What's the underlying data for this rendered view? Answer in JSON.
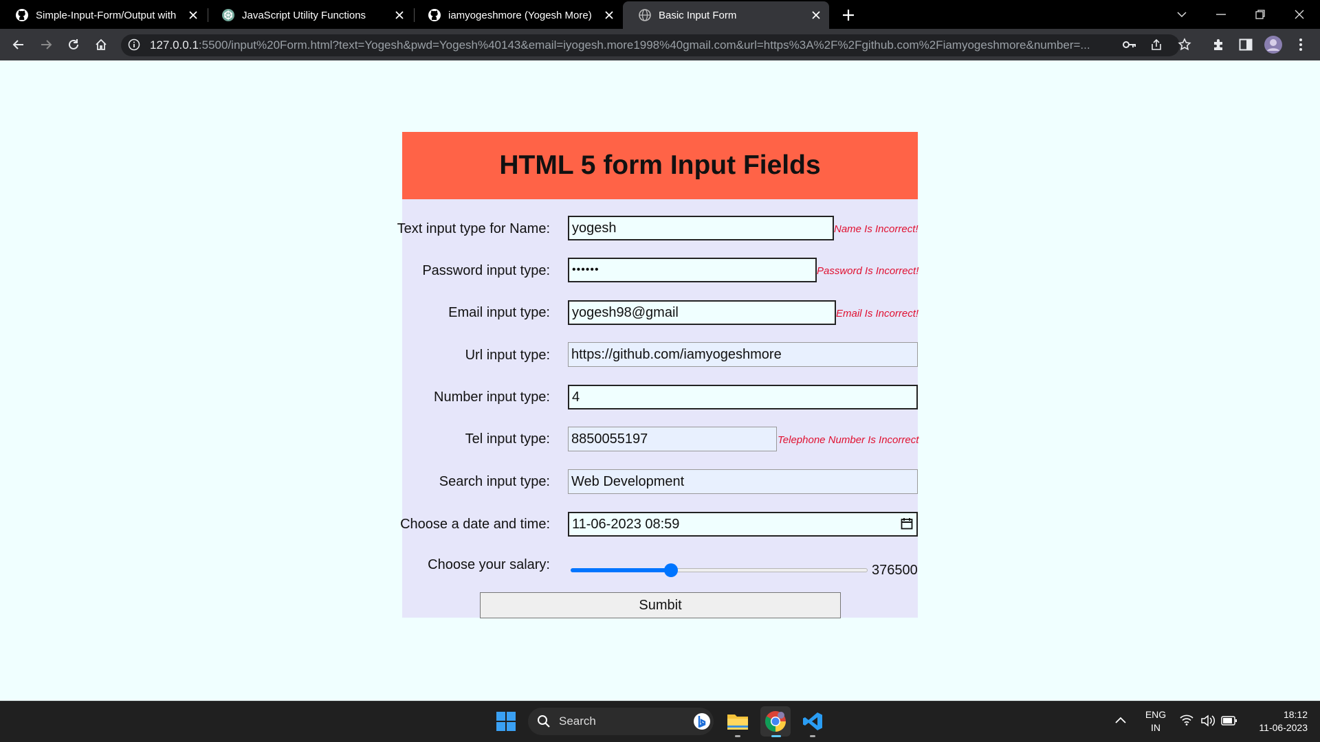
{
  "browser": {
    "tabs": [
      {
        "title": "Simple-Input-Form/Output with",
        "icon": "github-icon"
      },
      {
        "title": "JavaScript Utility Functions",
        "icon": "chatgpt-icon"
      },
      {
        "title": "iamyogeshmore (Yogesh More)",
        "icon": "github-icon"
      },
      {
        "title": "Basic Input Form",
        "icon": "globe-icon",
        "active": true
      }
    ],
    "url_host": "127.0.0.1",
    "url_rest": ":5500/input%20Form.html?text=Yogesh&pwd=Yogesh%40143&email=iyogesh.more1998%40gmail.com&url=https%3A%2F%2Fgithub.com%2Fiamyogeshmore&number=..."
  },
  "form": {
    "title": "HTML 5 form Input Fields",
    "fields": {
      "name": {
        "label": "Text input type for Name:",
        "value": "yogesh",
        "error": "Name Is Incorrect!"
      },
      "password": {
        "label": "Password input type:",
        "value": "••••••",
        "error": "Password Is Incorrect!"
      },
      "email": {
        "label": "Email input type:",
        "value": "yogesh98@gmail",
        "error": "Email Is Incorrect!"
      },
      "url": {
        "label": "Url input type:",
        "value": "https://github.com/iamyogeshmore"
      },
      "number": {
        "label": "Number input type:",
        "value": "4"
      },
      "tel": {
        "label": "Tel input type:",
        "value": "8850055197",
        "error": "Telephone Number Is Incorrect"
      },
      "search": {
        "label": "Search input type:",
        "value": "Web Development"
      },
      "datetime": {
        "label": "Choose a date and time:",
        "value": "11-06-2023 08:59"
      },
      "salary": {
        "label": "Choose your salary:",
        "value": "376500",
        "fraction": 0.33
      }
    },
    "submit_label": "Sumbit"
  },
  "colors": {
    "header": "#ff6347",
    "form_bg": "#e6e6fa",
    "page_bg": "#f0ffff",
    "error": "#e01030",
    "slider": "#0075ff"
  },
  "taskbar": {
    "search_label": "Search",
    "lang_top": "ENG",
    "lang_bottom": "IN",
    "time": "18:12",
    "date": "11-06-2023"
  }
}
